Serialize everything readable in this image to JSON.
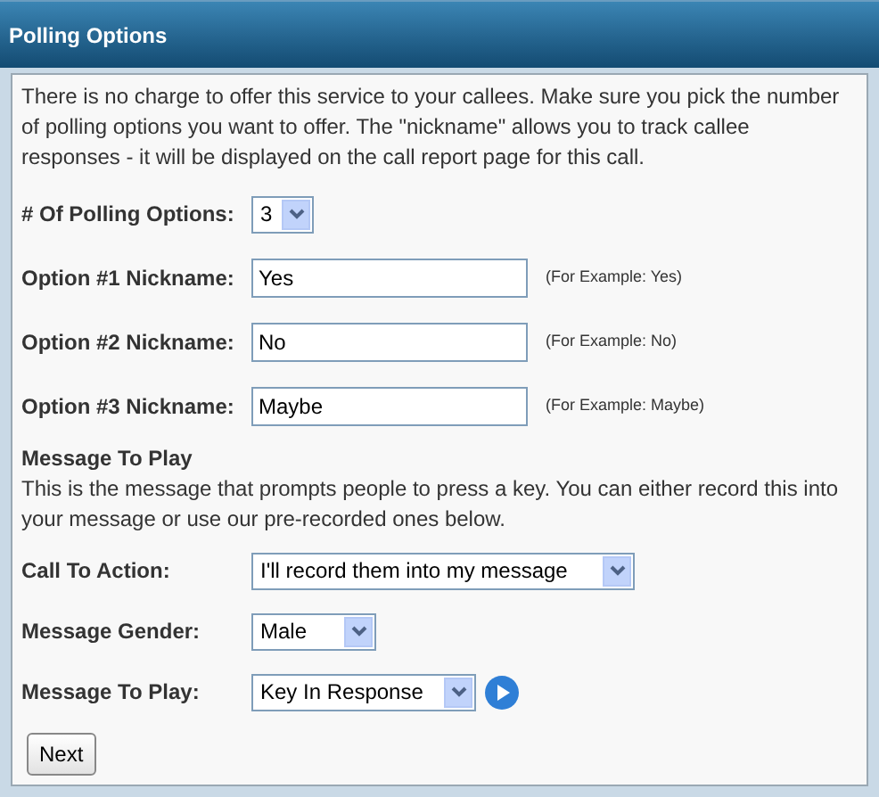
{
  "header": {
    "title": "Polling Options"
  },
  "intro": "There is no charge to offer this service to your callees. Make sure you pick the number of polling options you want to offer. The \"nickname\" allows you to track callee responses - it will be displayed on the call report page for this call.",
  "options_fields": [
    {
      "kind": "select",
      "label": "# Of Polling Options:",
      "value": "3"
    },
    {
      "kind": "text",
      "label": "Option #1 Nickname:",
      "value": "Yes",
      "hint": "(For Example: Yes)"
    },
    {
      "kind": "text",
      "label": "Option #2 Nickname:",
      "value": "No",
      "hint": "(For Example: No)"
    },
    {
      "kind": "text",
      "label": "Option #3 Nickname:",
      "value": "Maybe",
      "hint": "(For Example: Maybe)"
    }
  ],
  "message_section": {
    "heading": "Message To Play",
    "description": "This is the message that prompts people to press a key. You can either record this into your message or use our pre-recorded ones below."
  },
  "message_fields": [
    {
      "kind": "select",
      "label": "Call To Action:",
      "value": "I'll record them into my message"
    },
    {
      "kind": "select",
      "label": "Message Gender:",
      "value": "Male"
    },
    {
      "kind": "select",
      "label": "Message To Play:",
      "value": "Key In Response",
      "play": true
    }
  ],
  "buttons": [
    "Next"
  ]
}
